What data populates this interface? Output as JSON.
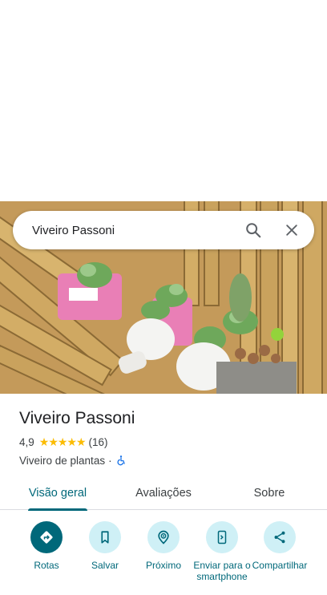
{
  "search": {
    "query": "Viveiro Passoni",
    "search_icon": "search-icon",
    "close_icon": "close-icon"
  },
  "place": {
    "name": "Viveiro Passoni",
    "rating": "4,9",
    "stars": "★★★★★",
    "star_count": 5,
    "reviews": "(16)",
    "category": "Viveiro de plantas",
    "separator": "·",
    "accessibility_icon": "wheelchair-icon"
  },
  "tabs": [
    {
      "label": "Visão geral",
      "active": true
    },
    {
      "label": "Avaliações",
      "active": false
    },
    {
      "label": "Sobre",
      "active": false
    }
  ],
  "actions": [
    {
      "label": "Rotas",
      "icon": "directions-icon"
    },
    {
      "label": "Salvar",
      "icon": "bookmark-icon"
    },
    {
      "label": "Próximo",
      "icon": "nearby-icon"
    },
    {
      "label": "Enviar para o smartphone",
      "icon": "send-to-phone-icon"
    },
    {
      "label": "Compartilhar",
      "icon": "share-icon"
    }
  ],
  "colors": {
    "accent": "#00687a",
    "accent_light": "#cff0f6",
    "star": "#fbbc04"
  }
}
